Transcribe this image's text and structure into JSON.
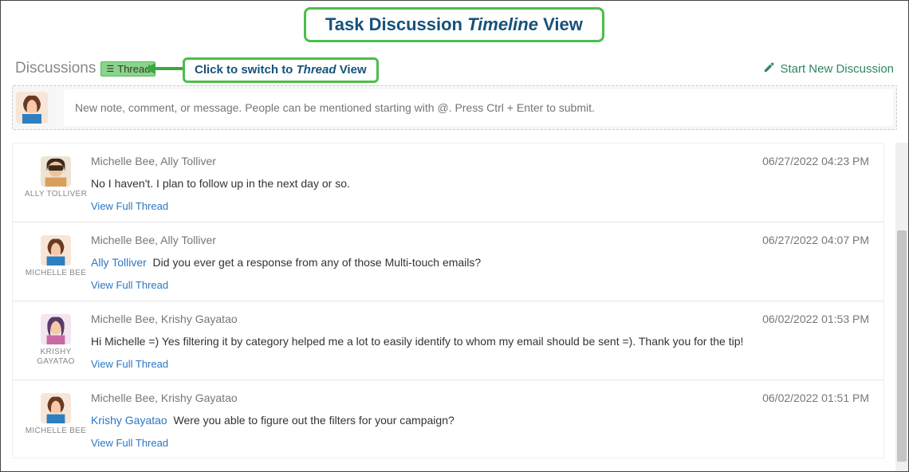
{
  "annotation": {
    "title_prefix": "Task Discussion ",
    "title_italic": "Timeline",
    "title_suffix": " View",
    "callout_prefix": "Click to switch to ",
    "callout_italic": "Thread",
    "callout_suffix": " View"
  },
  "header": {
    "discussions_label": "Discussions",
    "toggle_label": "Thread",
    "start_new_label": "Start New Discussion"
  },
  "compose": {
    "placeholder": "New note, comment, or message. People can be mentioned starting with @. Press Ctrl + Enter to submit."
  },
  "view_full_thread_label": "View Full Thread",
  "items": [
    {
      "avatar_name": "ALLY TOLLIVER",
      "participants": "Michelle Bee, Ally Tolliver",
      "timestamp": "06/27/2022 04:23 PM",
      "mention": "",
      "message": "No I haven't. I plan to follow up in the next day or so."
    },
    {
      "avatar_name": "MICHELLE BEE",
      "participants": "Michelle Bee, Ally Tolliver",
      "timestamp": "06/27/2022 04:07 PM",
      "mention": "Ally Tolliver",
      "message": "Did you ever get a response from any of those Multi-touch emails?"
    },
    {
      "avatar_name": "KRISHY GAYATAO",
      "participants": "Michelle Bee, Krishy Gayatao",
      "timestamp": "06/02/2022 01:53 PM",
      "mention": "",
      "message": "Hi Michelle =) Yes filtering it by category helped me a lot to easily identify to whom my email should be sent =). Thank you for the tip!"
    },
    {
      "avatar_name": "MICHELLE BEE",
      "participants": "Michelle Bee, Krishy Gayatao",
      "timestamp": "06/02/2022 01:51 PM",
      "mention": "Krishy Gayatao",
      "message": "Were you able to figure out the filters for your campaign?"
    }
  ]
}
